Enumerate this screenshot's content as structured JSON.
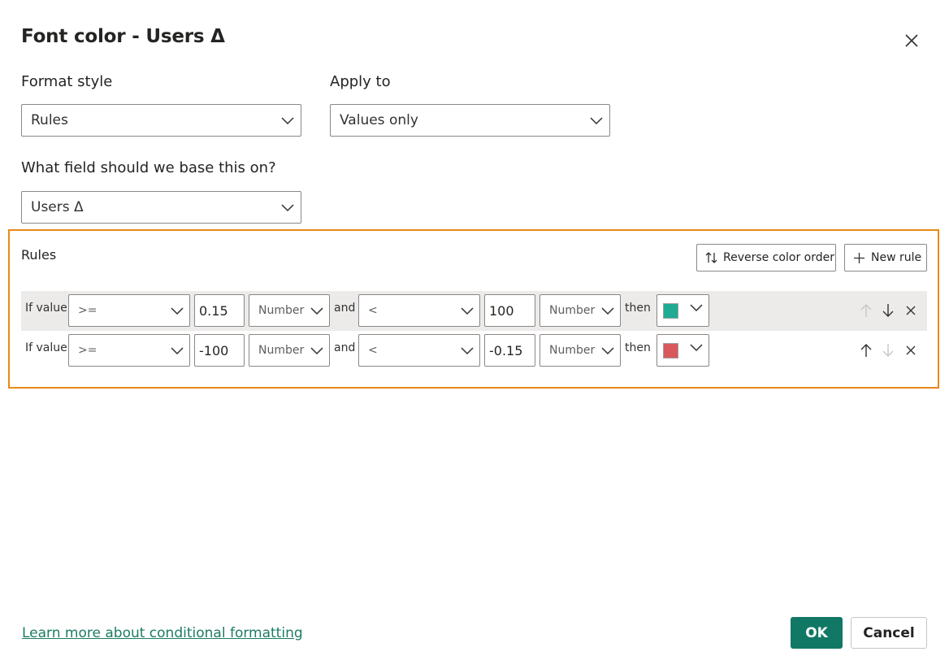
{
  "dialog": {
    "title": "Font color - Users Δ",
    "format_style_label": "Format style",
    "format_style_value": "Rules",
    "apply_to_label": "Apply to",
    "apply_to_value": "Values only",
    "field_label": "What field should we base this on?",
    "field_value": "Users Δ"
  },
  "rules": {
    "title": "Rules",
    "reverse_label": "Reverse color order",
    "new_rule_label": "New rule",
    "items": [
      {
        "if_label": "If value",
        "op1": ">=",
        "val1": "0.15",
        "type1": "Number",
        "and_label": "and",
        "op2": "<",
        "val2": "100",
        "type2": "Number",
        "then_label": "then",
        "color": "#1fab94"
      },
      {
        "if_label": "If value",
        "op1": ">=",
        "val1": "-100",
        "type1": "Number",
        "and_label": "and",
        "op2": "<",
        "val2": "-0.15",
        "type2": "Number",
        "then_label": "then",
        "color": "#d8585b"
      }
    ]
  },
  "footer": {
    "learn_more": "Learn more about conditional formatting",
    "ok": "OK",
    "cancel": "Cancel"
  },
  "colors": {
    "accent": "#117865",
    "highlight_border": "#e8891a"
  }
}
